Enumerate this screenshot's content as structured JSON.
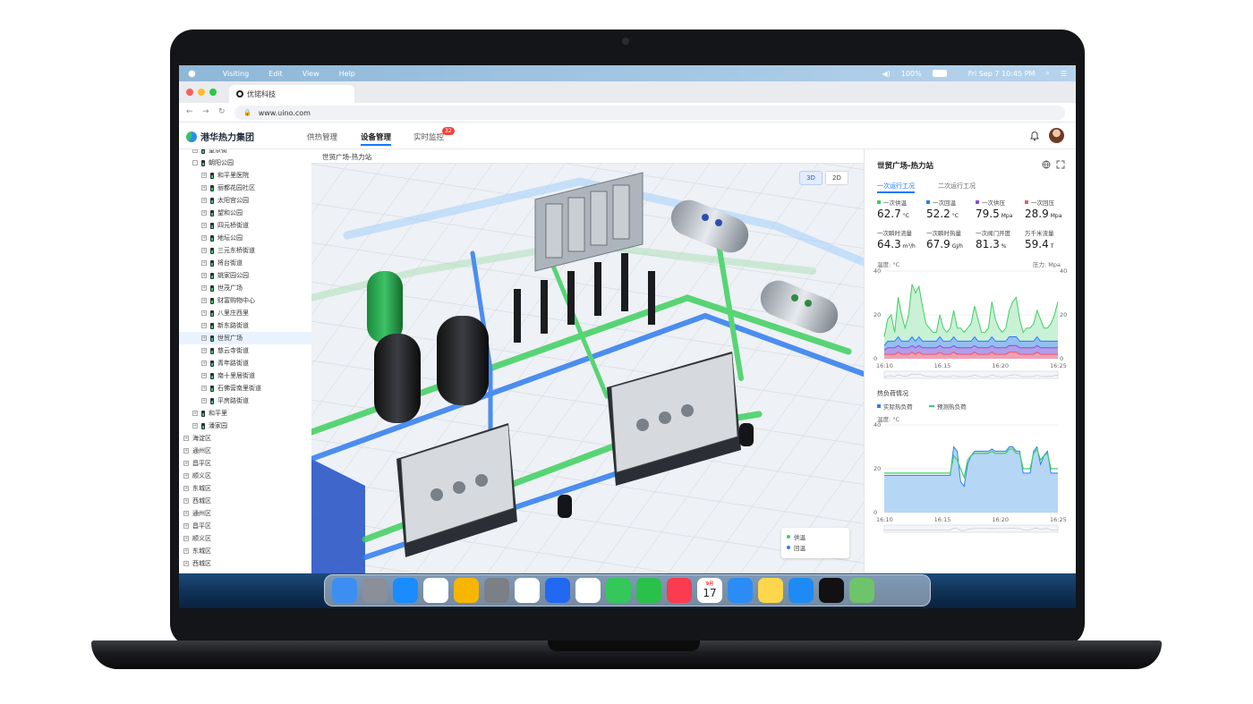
{
  "macos": {
    "menus": [
      "Visiting",
      "Edit",
      "View",
      "Help"
    ],
    "status": {
      "volume": "100%",
      "datetime": "Fri Sep 7 10:45 PM"
    }
  },
  "browser": {
    "tab_title": "优锘科技",
    "url": "www.uino.com"
  },
  "app": {
    "brand": "港华热力集团",
    "tabs": [
      {
        "label": "供热管理",
        "active": false
      },
      {
        "label": "设备管理",
        "active": true
      },
      {
        "label": "实时监控",
        "active": false
      }
    ],
    "alert_count": "32"
  },
  "tree": {
    "items": [
      {
        "label": "望京街",
        "level": 2,
        "kind": "node",
        "expander": "+"
      },
      {
        "label": "朝阳公园",
        "level": 2,
        "kind": "node",
        "expander": "-"
      },
      {
        "label": "和平里医院",
        "level": 3,
        "kind": "node",
        "expander": "+"
      },
      {
        "label": "丽都花园社区",
        "level": 3,
        "kind": "node",
        "expander": "+"
      },
      {
        "label": "太阳宫公园",
        "level": 3,
        "kind": "node",
        "expander": "+"
      },
      {
        "label": "望和公园",
        "level": 3,
        "kind": "node",
        "expander": "+"
      },
      {
        "label": "四元桥街道",
        "level": 3,
        "kind": "node",
        "expander": "+"
      },
      {
        "label": "地坛公园",
        "level": 3,
        "kind": "node",
        "expander": "+"
      },
      {
        "label": "三元东桥街道",
        "level": 3,
        "kind": "node",
        "expander": "+"
      },
      {
        "label": "将台街道",
        "level": 3,
        "kind": "node",
        "expander": "+"
      },
      {
        "label": "姚家园公园",
        "level": 3,
        "kind": "node",
        "expander": "+"
      },
      {
        "label": "世茂广场",
        "level": 3,
        "kind": "node",
        "expander": "+"
      },
      {
        "label": "财富购物中心",
        "level": 3,
        "kind": "node",
        "expander": "+"
      },
      {
        "label": "八里庄西里",
        "level": 3,
        "kind": "node",
        "expander": "+"
      },
      {
        "label": "新东路街道",
        "level": 3,
        "kind": "node",
        "expander": "+"
      },
      {
        "label": "世贸广场",
        "level": 3,
        "kind": "node",
        "expander": "+",
        "selected": true
      },
      {
        "label": "慈云寺街道",
        "level": 3,
        "kind": "node",
        "expander": "+"
      },
      {
        "label": "青年路街道",
        "level": 3,
        "kind": "node",
        "expander": "+"
      },
      {
        "label": "南十里居街道",
        "level": 3,
        "kind": "node",
        "expander": "+"
      },
      {
        "label": "石佛营南里街道",
        "level": 3,
        "kind": "node",
        "expander": "+"
      },
      {
        "label": "平房路街道",
        "level": 3,
        "kind": "node",
        "expander": "+"
      },
      {
        "label": "和平里",
        "level": 2,
        "kind": "node",
        "expander": "+"
      },
      {
        "label": "潘家园",
        "level": 2,
        "kind": "node",
        "expander": "+"
      },
      {
        "label": "海淀区",
        "level": 1,
        "kind": "district",
        "expander": "+"
      },
      {
        "label": "通州区",
        "level": 1,
        "kind": "district",
        "expander": "+"
      },
      {
        "label": "昌平区",
        "level": 1,
        "kind": "district",
        "expander": "+"
      },
      {
        "label": "顺义区",
        "level": 1,
        "kind": "district",
        "expander": "+"
      },
      {
        "label": "东城区",
        "level": 1,
        "kind": "district",
        "expander": "+"
      },
      {
        "label": "西城区",
        "level": 1,
        "kind": "district",
        "expander": "+"
      },
      {
        "label": "通州区",
        "level": 1,
        "kind": "district",
        "expander": "+"
      },
      {
        "label": "昌平区",
        "level": 1,
        "kind": "district",
        "expander": "+"
      },
      {
        "label": "顺义区",
        "level": 1,
        "kind": "district",
        "expander": "+"
      },
      {
        "label": "东城区",
        "level": 1,
        "kind": "district",
        "expander": "+"
      },
      {
        "label": "西城区",
        "level": 1,
        "kind": "district",
        "expander": "+"
      }
    ]
  },
  "viewport": {
    "breadcrumb": "世贸广场-热力站",
    "mode_3d": "3D",
    "mode_2d": "2D",
    "active_mode": "3D",
    "legend": [
      {
        "label": "供温",
        "color": "#3fcf5f"
      },
      {
        "label": "回温",
        "color": "#2f7cf0"
      }
    ]
  },
  "panel": {
    "title": "世贸广场-热力站",
    "subtabs": [
      {
        "label": "一次运行工况",
        "active": true
      },
      {
        "label": "二次运行工况",
        "active": false
      }
    ],
    "metrics": [
      {
        "label": "一次供温",
        "value": "62.7",
        "unit": "°C",
        "color": "#3fcf5f"
      },
      {
        "label": "一次回温",
        "value": "52.2",
        "unit": "°C",
        "color": "#2f7cf0"
      },
      {
        "label": "一次供压",
        "value": "79.5",
        "unit": "Mpa",
        "color": "#8a4fd8"
      },
      {
        "label": "一次回压",
        "value": "28.9",
        "unit": "Mpa",
        "color": "#f0566b"
      },
      {
        "label": "一次瞬时流量",
        "value": "64.3",
        "unit": "m³/h"
      },
      {
        "label": "一次瞬时热量",
        "value": "67.9",
        "unit": "GJ/h"
      },
      {
        "label": "一次阀门开度",
        "value": "81.3",
        "unit": "%"
      },
      {
        "label": "万千米流量",
        "value": "59.4",
        "unit": "T"
      }
    ],
    "colors": {
      "green": "#3fcf5f",
      "blue": "#2f7cf0",
      "purple": "#8a4fd8",
      "red": "#f0566b",
      "accent": "#1677ff"
    },
    "heat_title": "热负荷情况",
    "heat_legend": [
      "实际热负荷",
      "预测热负荷"
    ]
  },
  "chart_data": [
    {
      "type": "area",
      "ylabel_left": "温度: °C",
      "ylabel_right": "压力: Mpa",
      "ylim": [
        0,
        40
      ],
      "y_ticks_left": [
        "40",
        "20",
        "0"
      ],
      "y_ticks_right": [
        "40",
        "20",
        "0"
      ],
      "x_ticks": [
        "16:10",
        "16:15",
        "16:20",
        "16:25"
      ],
      "x": [
        0,
        2,
        4,
        6,
        8,
        10,
        12,
        14,
        16,
        18,
        20,
        22,
        24,
        26,
        28,
        30,
        32,
        34,
        36,
        38,
        40,
        42,
        44,
        46,
        48,
        50,
        52,
        54,
        56,
        58,
        60,
        62,
        64,
        66,
        68,
        70,
        72,
        74,
        76,
        78,
        80,
        82,
        84,
        86,
        88,
        90,
        92,
        94,
        96,
        98,
        100
      ],
      "series": [
        {
          "values": [
            10,
            18,
            20,
            12,
            28,
            20,
            14,
            20,
            34,
            30,
            33,
            24,
            16,
            14,
            12,
            12,
            20,
            14,
            12,
            14,
            22,
            14,
            14,
            12,
            14,
            16,
            24,
            18,
            12,
            12,
            14,
            26,
            18,
            14,
            12,
            14,
            22,
            26,
            28,
            18,
            12,
            14,
            14,
            16,
            22,
            18,
            14,
            14,
            16,
            20,
            26
          ]
        },
        {
          "values": [
            6,
            8,
            8,
            8,
            10,
            8,
            8,
            8,
            10,
            8,
            10,
            8,
            8,
            8,
            8,
            8,
            10,
            8,
            8,
            8,
            10,
            8,
            8,
            8,
            8,
            8,
            10,
            8,
            8,
            8,
            8,
            10,
            8,
            8,
            8,
            8,
            10,
            10,
            10,
            8,
            8,
            8,
            8,
            8,
            10,
            8,
            8,
            8,
            8,
            8,
            8
          ]
        },
        {
          "values": [
            4,
            5,
            5,
            5,
            6,
            5,
            5,
            5,
            6,
            5,
            6,
            5,
            5,
            5,
            5,
            5,
            6,
            5,
            5,
            5,
            6,
            5,
            5,
            5,
            5,
            5,
            6,
            5,
            5,
            5,
            5,
            6,
            5,
            5,
            5,
            5,
            6,
            6,
            6,
            5,
            5,
            5,
            5,
            5,
            6,
            5,
            5,
            5,
            5,
            5,
            5
          ]
        },
        {
          "values": [
            2,
            2,
            2,
            2,
            3,
            2,
            2,
            2,
            3,
            2,
            3,
            2,
            2,
            2,
            2,
            2,
            3,
            2,
            2,
            2,
            3,
            2,
            2,
            2,
            2,
            2,
            3,
            2,
            2,
            2,
            2,
            3,
            2,
            2,
            2,
            2,
            3,
            3,
            3,
            2,
            2,
            2,
            2,
            2,
            3,
            2,
            2,
            2,
            2,
            2,
            2
          ]
        }
      ]
    },
    {
      "type": "area",
      "ylabel": "温度: °C",
      "ylim": [
        0,
        40
      ],
      "y_ticks": [
        "40",
        "20",
        "0"
      ],
      "x_ticks": [
        "16:10",
        "16:15",
        "16:20",
        "16:25"
      ],
      "x": [
        0,
        2,
        4,
        6,
        8,
        10,
        12,
        14,
        16,
        18,
        20,
        22,
        24,
        26,
        28,
        30,
        32,
        34,
        36,
        38,
        40,
        42,
        44,
        46,
        48,
        50,
        52,
        54,
        56,
        58,
        60,
        62,
        64,
        66,
        68,
        70,
        72,
        74,
        76,
        78,
        80,
        82,
        84,
        86,
        88,
        90,
        92,
        94,
        96,
        98,
        100
      ],
      "series": [
        {
          "name": "实际热负荷",
          "values": [
            17,
            17,
            17,
            17,
            17,
            17,
            17,
            17,
            17,
            17,
            17,
            17,
            17,
            17,
            17,
            17,
            17,
            17,
            17,
            17,
            30,
            28,
            14,
            12,
            22,
            26,
            28,
            28,
            28,
            28,
            28,
            29,
            28,
            28,
            28,
            28,
            30,
            30,
            28,
            28,
            18,
            18,
            18,
            28,
            30,
            22,
            26,
            28,
            18,
            18,
            18
          ]
        },
        {
          "name": "预测热负荷",
          "values": [
            18,
            18,
            18,
            18,
            18,
            18,
            18,
            18,
            18,
            18,
            18,
            18,
            18,
            18,
            18,
            18,
            18,
            18,
            18,
            18,
            26,
            24,
            20,
            16,
            24,
            26,
            27,
            27,
            27,
            27,
            27,
            28,
            27,
            27,
            27,
            27,
            29,
            29,
            27,
            27,
            20,
            20,
            20,
            27,
            29,
            24,
            26,
            27,
            20,
            20,
            20
          ]
        }
      ]
    }
  ],
  "dock": {
    "calendar_month": "9月",
    "calendar_day": "17",
    "apps": [
      "finder",
      "launchpad",
      "safari",
      "chrome",
      "sketch",
      "settings",
      "photos",
      "ithome",
      "reminders",
      "messages",
      "facetime",
      "music",
      "calendar",
      "mail",
      "notes",
      "appstore",
      "appletv",
      "maps"
    ]
  }
}
